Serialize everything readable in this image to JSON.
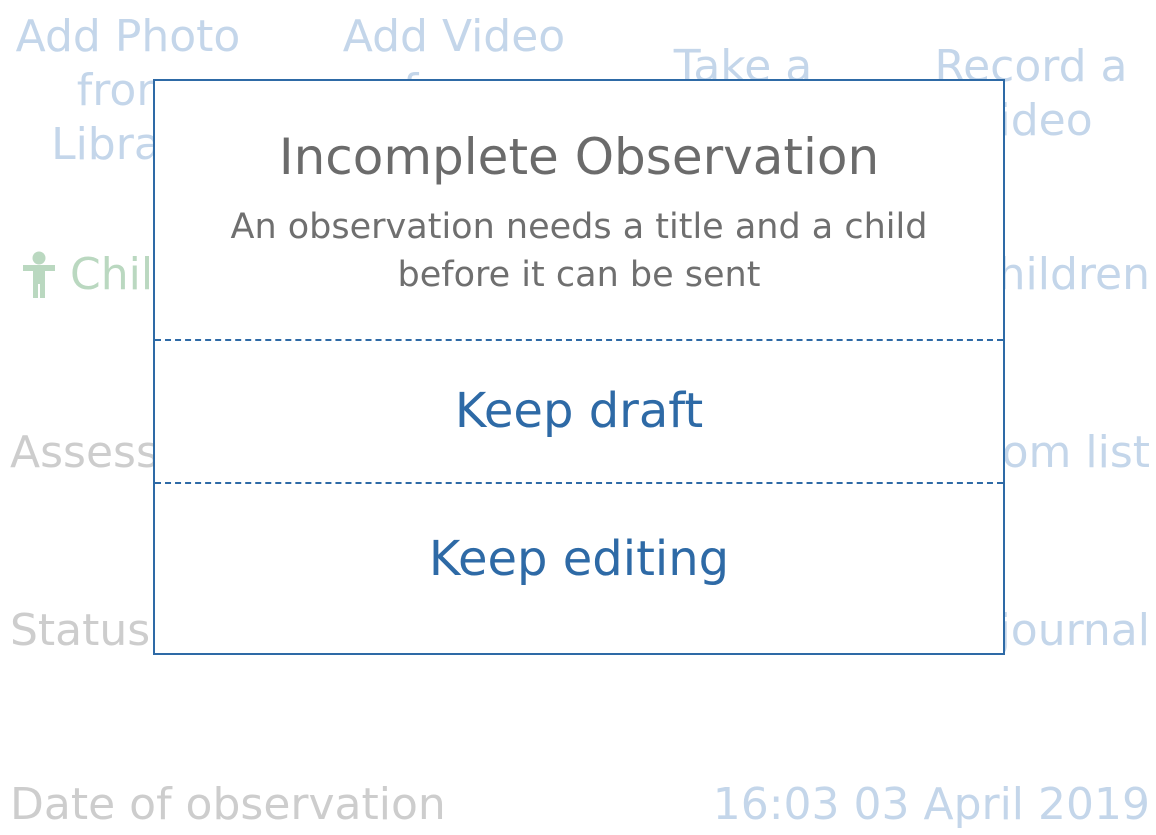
{
  "media_buttons": [
    {
      "label": "Add Photo\nfrom\nLibrary"
    },
    {
      "label": "Add Video\nfrom\nLibrary"
    },
    {
      "label": "Take a\nPhoto"
    },
    {
      "label": "Record a\nVideo"
    }
  ],
  "rows": {
    "children": {
      "label": "Children",
      "value": "Add Children"
    },
    "assessment": {
      "label": "Assessment",
      "value": "Select from list"
    },
    "status": {
      "label": "Status",
      "value": "Send to journal"
    },
    "date": {
      "label": "Date of observation",
      "value": "16:03 03 April 2019"
    }
  },
  "dialog": {
    "title": "Incomplete Observation",
    "message": "An observation needs a title and a child\nbefore it can be sent",
    "buttons": {
      "keep_draft": "Keep draft",
      "keep_editing": "Keep editing"
    }
  },
  "colors": {
    "accent": "#2e6aa6",
    "faded_link": "#c4d6ea",
    "faded_label": "#cdcdcd",
    "faded_child": "#bad8c0"
  },
  "icons": {
    "children": "child-person-icon"
  }
}
